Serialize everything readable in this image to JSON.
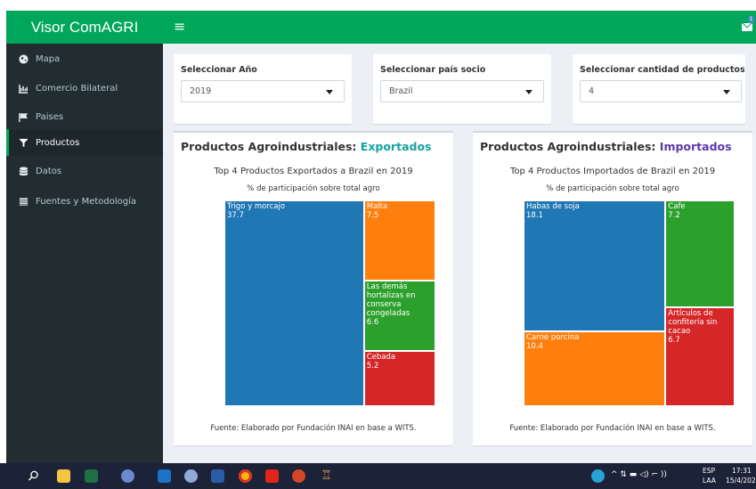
{
  "app": {
    "title": "Visor ComAGRI"
  },
  "header": {
    "menu_glyph": "≡",
    "notification_count": "1"
  },
  "sidebar": {
    "items": [
      {
        "label": "Mapa",
        "icon": "globe-icon"
      },
      {
        "label": "Comercio Bilateral",
        "icon": "line-chart-icon"
      },
      {
        "label": "Paises",
        "icon": "flag-icon"
      },
      {
        "label": "Productos",
        "icon": "funnel-icon",
        "active": true
      },
      {
        "label": "Datos",
        "icon": "database-icon"
      },
      {
        "label": "Fuentes y Metodología",
        "icon": "book-icon"
      }
    ]
  },
  "filters": {
    "year": {
      "label": "Seleccionar Año",
      "value": "2019"
    },
    "country": {
      "label": "Seleccionar país socio",
      "value": "Brazil"
    },
    "count": {
      "label": "Seleccionar cantidad de productos",
      "value": "4"
    }
  },
  "exports_panel": {
    "title_prefix": "Productos Agroindustriales: ",
    "title_highlight": "Exportados",
    "source": "Fuente: Elaborado por Fundación INAI en base a WITS."
  },
  "imports_panel": {
    "title_prefix": "Productos Agroindustriales: ",
    "title_highlight": "Importados",
    "source": "Fuente: Elaborado por Fundación INAI en base a WITS."
  },
  "chart_data": [
    {
      "type": "treemap",
      "title": "Top 4 Productos Exportados a Brazil en 2019",
      "subtitle": "% de participación sobre total agro",
      "items": [
        {
          "label": "Trigo y morcajo",
          "value": 37.7,
          "color": "#1f77b4"
        },
        {
          "label": "Malta",
          "value": 7.5,
          "color": "#ff7f0e"
        },
        {
          "label": "Las demás hortalizas en conserva congeladas",
          "value": 6.6,
          "color": "#2ca02c"
        },
        {
          "label": "Cebada",
          "value": 5.2,
          "color": "#d62728"
        }
      ]
    },
    {
      "type": "treemap",
      "title": "Top 4 Productos Importados de Brazil en 2019",
      "subtitle": "% de participación sobre total agro",
      "items": [
        {
          "label": "Habas de soja",
          "value": 18.1,
          "color": "#1f77b4"
        },
        {
          "label": "Cafe",
          "value": 7.2,
          "color": "#2ca02c"
        },
        {
          "label": "Carne porcina",
          "value": 10.4,
          "color": "#ff7f0e"
        },
        {
          "label": "Artículos de confitería sin cacao",
          "value": 6.7,
          "color": "#d62728"
        }
      ]
    }
  ],
  "taskbar": {
    "language": "ESP",
    "layout": "LAA",
    "time": "17:31",
    "date": "15/4/202"
  }
}
